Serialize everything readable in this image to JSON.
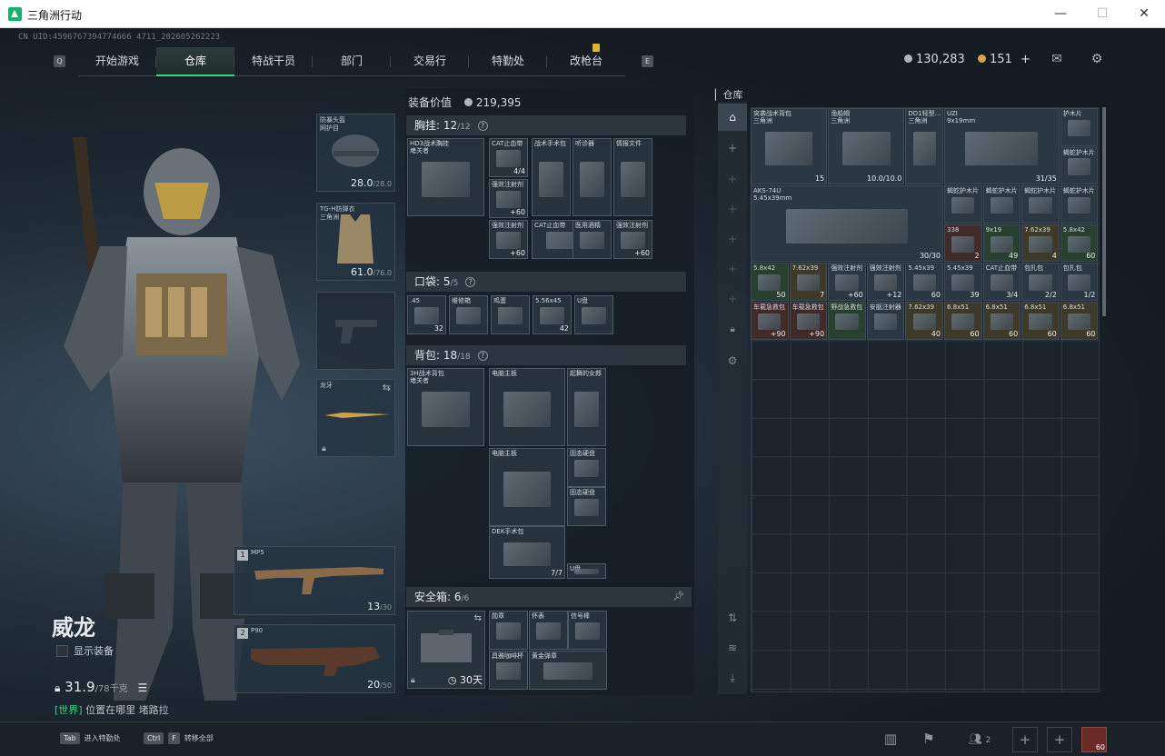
{
  "window": {
    "title": "三角洲行动",
    "minimize": "—",
    "maximize": "☐",
    "close": "✕"
  },
  "uid": "CN UID:4596767394774666 4711_202605262223",
  "nav": {
    "key_left": "Q",
    "key_right": "E",
    "tabs": [
      "开始游戏",
      "仓库",
      "特战干员",
      "部门",
      "交易行",
      "特勤处",
      "改枪台"
    ],
    "active": 1
  },
  "currency": {
    "silver": "130,283",
    "gold": "151",
    "plus": "+"
  },
  "icons": {
    "mail": "envelope-icon",
    "settings": "gear-icon"
  },
  "character": {
    "name": "威龙",
    "show_equip": "显示装备",
    "weight": "31.9",
    "weight_max": "/78千克",
    "world_tag": "[世界]",
    "world_text": "位置在哪里 堵路拉"
  },
  "slots": {
    "helmet": {
      "label": "防暴头盔\n网护目",
      "dur": "28.0",
      "max": "/28.0"
    },
    "armor": {
      "label": "TG-H防弹衣\n三角洲",
      "dur": "61.0",
      "max": "/76.0"
    },
    "melee": {
      "label": "龙牙"
    },
    "primary": {
      "num": "1",
      "name": "MP5",
      "ammo": "13",
      "max": "/30"
    },
    "secondary": {
      "num": "2",
      "name": "P90",
      "ammo": "20",
      "max": "/50"
    }
  },
  "equip": {
    "value_label": "装备价值",
    "value": "219,395",
    "chest": {
      "title": "胸挂:",
      "count": "12",
      "max": "/12",
      "q": "?"
    },
    "chest_items": [
      {
        "name": "HD3战术胸挂\n堵关者",
        "ct": ""
      },
      {
        "name": "CAT止血带",
        "ct": "4/4"
      },
      {
        "name": "战术手术包",
        "ct": ""
      },
      {
        "name": "听诊器",
        "ct": ""
      },
      {
        "name": "情报文件",
        "ct": ""
      },
      {
        "name": "强效注射剂",
        "ct": "+60"
      },
      {
        "name": "强效注射剂",
        "ct": "+60"
      },
      {
        "name": "CAT止血带",
        "ct": "4/4"
      },
      {
        "name": "医用酒精",
        "ct": ""
      },
      {
        "name": "强效注射剂",
        "ct": "+60"
      }
    ],
    "pocket": {
      "title": "口袋:",
      "count": "5",
      "max": "/5",
      "q": "?"
    },
    "pocket_items": [
      {
        "name": ".45",
        "ct": "32"
      },
      {
        "name": "维修箱",
        "ct": ""
      },
      {
        "name": "鸡蛋",
        "ct": ""
      },
      {
        "name": "5.56x45",
        "ct": "42"
      },
      {
        "name": "U盘",
        "ct": ""
      }
    ],
    "backpack": {
      "title": "背包:",
      "count": "18",
      "max": "/18",
      "q": "?"
    },
    "backpack_items": [
      {
        "name": "3H战术背包\n堵关者",
        "ct": ""
      },
      {
        "name": "电脑主板",
        "ct": ""
      },
      {
        "name": "起舞的女郎",
        "ct": ""
      },
      {
        "name": "电脑主板",
        "ct": ""
      },
      {
        "name": "固态硬盘",
        "ct": ""
      },
      {
        "name": "固态硬盘",
        "ct": ""
      },
      {
        "name": "DEK手术包",
        "ct": "7/7"
      },
      {
        "name": "U盘",
        "ct": ""
      }
    ],
    "safe": {
      "title": "安全箱:",
      "count": "6",
      "max": "/6",
      "days": "30天"
    },
    "safe_items": [
      {
        "name": "勋章",
        "ct": ""
      },
      {
        "name": "怀表",
        "ct": ""
      },
      {
        "name": "信号棒",
        "ct": ""
      },
      {
        "name": "具雅咖啡杯",
        "ct": ""
      },
      {
        "name": "黄金弹章",
        "ct": ""
      }
    ]
  },
  "warehouse": {
    "title": "仓库",
    "items": [
      {
        "name": "突袭战术背包\n三角洲",
        "ct": "15",
        "cls": ""
      },
      {
        "name": "渔船帽\n三角洲",
        "ct": "10.0/10.0",
        "cls": ""
      },
      {
        "name": "DD1轻型...\n三角洲",
        "ct": "",
        "cls": ""
      },
      {
        "name": "UZI\n9x19mm",
        "ct": "31/35",
        "cls": ""
      },
      {
        "name": "护木片",
        "ct": "",
        "cls": ""
      },
      {
        "name": "蝎蛇护木片",
        "ct": "",
        "cls": ""
      },
      {
        "name": "AKS-74U\n5.45x39mm",
        "ct": "30/30",
        "cls": ""
      },
      {
        "name": "蝎蛇护木片",
        "ct": "",
        "cls": ""
      },
      {
        "name": "蝎蛇护木片",
        "ct": "",
        "cls": ""
      },
      {
        "name": "蝎蛇护木片",
        "ct": "",
        "cls": ""
      },
      {
        "name": "蝎蛇护木片",
        "ct": "",
        "cls": ""
      },
      {
        "name": "338",
        "ct": "2",
        "cls": "red"
      },
      {
        "name": "9x19",
        "ct": "49",
        "cls": "green"
      },
      {
        "name": "7.62x39",
        "ct": "4",
        "cls": "gold"
      },
      {
        "name": "5.8x42",
        "ct": "60",
        "cls": "green"
      },
      {
        "name": "5.8x42",
        "ct": "50",
        "cls": "green"
      },
      {
        "name": "7.62x39",
        "ct": "7",
        "cls": "gold"
      },
      {
        "name": "强效注射剂",
        "ct": "+60",
        "cls": ""
      },
      {
        "name": "强效注射剂",
        "ct": "+12",
        "cls": ""
      },
      {
        "name": "5.45x39",
        "ct": "60",
        "cls": ""
      },
      {
        "name": "5.45x39",
        "ct": "39",
        "cls": ""
      },
      {
        "name": "CAT止血带",
        "ct": "3/4",
        "cls": ""
      },
      {
        "name": "包扎包",
        "ct": "2/2",
        "cls": ""
      },
      {
        "name": "包扎包",
        "ct": "1/2",
        "cls": ""
      },
      {
        "name": "车载急救包",
        "ct": "+90",
        "cls": "red"
      },
      {
        "name": "车载急救包",
        "ct": "+90",
        "cls": "red"
      },
      {
        "name": "野战急救包",
        "ct": "",
        "cls": "green"
      },
      {
        "name": "安瓿注射器",
        "ct": "",
        "cls": ""
      },
      {
        "name": "7.62x39",
        "ct": "40",
        "cls": "gold"
      },
      {
        "name": "6.8x51",
        "ct": "60",
        "cls": "gold"
      },
      {
        "name": "6.8x51",
        "ct": "60",
        "cls": "gold"
      },
      {
        "name": "6.8x51",
        "ct": "60",
        "cls": "gold"
      },
      {
        "name": "6.8x51",
        "ct": "60",
        "cls": "gold"
      }
    ]
  },
  "bottom": {
    "tab_key": "Tab",
    "tab_hint": "进入特勤处",
    "ctrl_key": "Ctrl",
    "f_key": "F",
    "ctrl_hint": "转移全部",
    "team_count": "2",
    "plus": "+",
    "avatar_level": "60"
  }
}
